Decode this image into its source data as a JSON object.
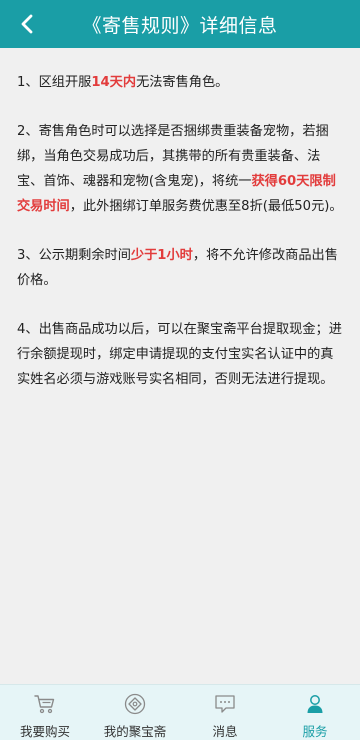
{
  "header": {
    "title": "《寄售规则》详细信息"
  },
  "rules": [
    {
      "segments": [
        {
          "text": "1、区组开服",
          "highlight": false
        },
        {
          "text": "14天内",
          "highlight": true
        },
        {
          "text": "无法寄售角色。",
          "highlight": false
        }
      ]
    },
    {
      "segments": [
        {
          "text": "2、寄售角色时可以选择是否捆绑贵重装备宠物，若捆绑，当角色交易成功后，其携带的所有贵重装备、法宝、首饰、魂器和宠物(含鬼宠)，将统一",
          "highlight": false
        },
        {
          "text": "获得60天限制交易时间",
          "highlight": true
        },
        {
          "text": "，此外捆绑订单服务费优惠至8折(最低50元)。",
          "highlight": false
        }
      ]
    },
    {
      "segments": [
        {
          "text": "3、公示期剩余时间",
          "highlight": false
        },
        {
          "text": "少于1小时",
          "highlight": true
        },
        {
          "text": "，将不允许修改商品出售价格。",
          "highlight": false
        }
      ]
    },
    {
      "segments": [
        {
          "text": "4、出售商品成功以后，可以在聚宝斋平台提取现金；进行余额提现时，绑定申请提现的支付宝实名认证中的真实姓名必须与游戏账号实名相同，否则无法进行提现。",
          "highlight": false
        }
      ]
    }
  ],
  "tabbar": {
    "items": [
      {
        "label": "我要购买",
        "icon": "cart-icon",
        "active": false
      },
      {
        "label": "我的聚宝斋",
        "icon": "treasure-icon",
        "active": false
      },
      {
        "label": "消息",
        "icon": "message-icon",
        "active": false
      },
      {
        "label": "服务",
        "icon": "user-icon",
        "active": true
      }
    ]
  },
  "colors": {
    "header": "#1a9ea6",
    "highlight": "#e23c3c",
    "tabbar_bg": "#e6f5f7",
    "active": "#1a9ea6"
  }
}
